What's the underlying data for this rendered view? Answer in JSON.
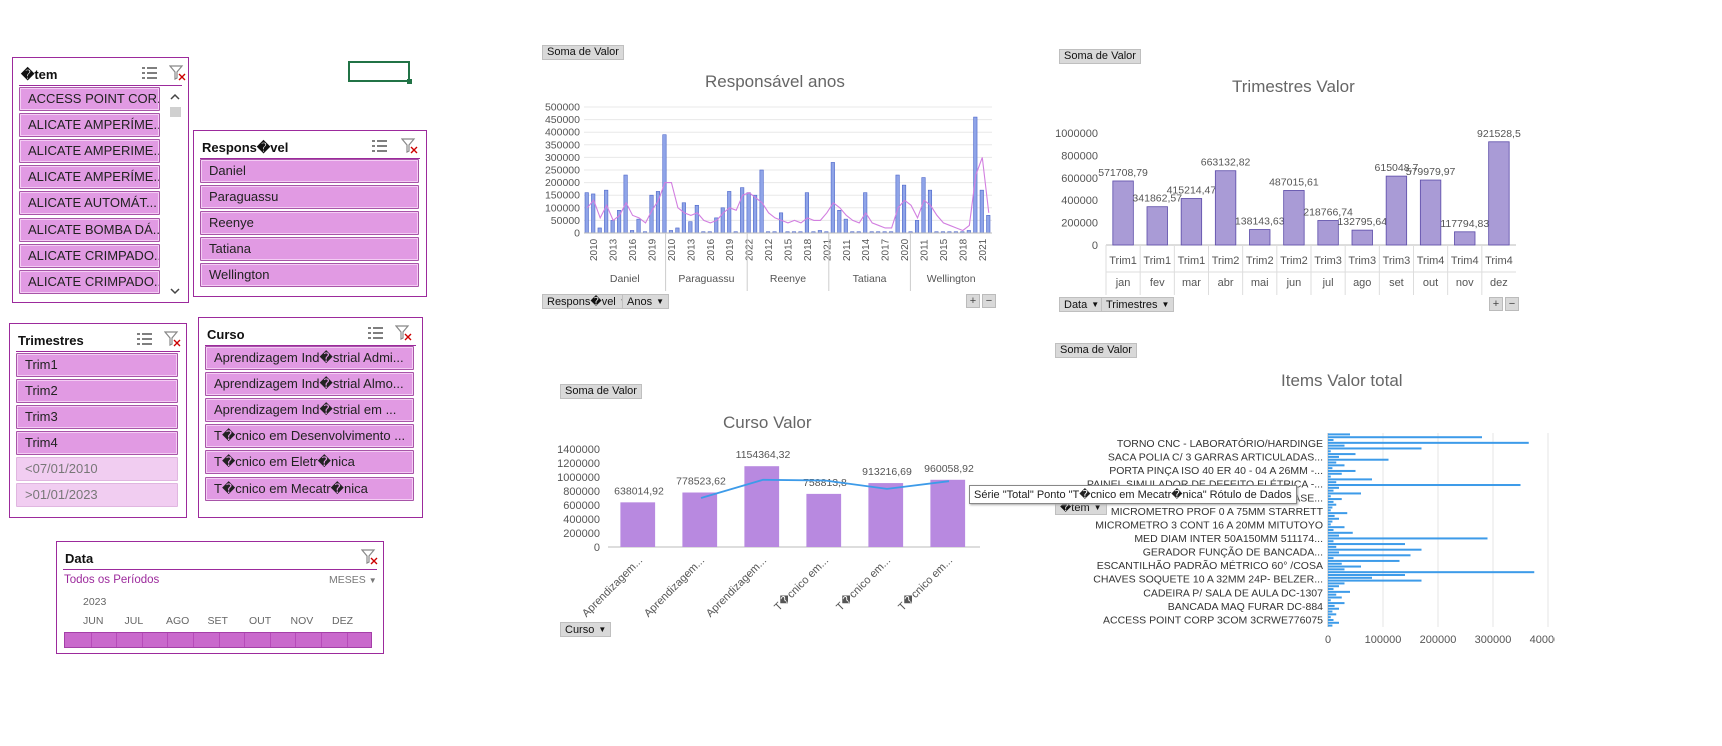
{
  "slicers": {
    "item": {
      "title": "�tem",
      "items": [
        "ACCESS POINT COR...",
        "ALICATE AMPERÍME...",
        "ALICATE AMPERIME...",
        "ALICATE AMPERÍME...",
        "ALICATE AUTOMÁT...",
        "ALICATE BOMBA DÁ...",
        "ALICATE CRIMPADO...",
        "ALICATE CRIMPADO..."
      ]
    },
    "responsavel": {
      "title": "Respons�vel",
      "items": [
        "Daniel",
        "Paraguassu",
        "Reenye",
        "Tatiana",
        "Wellington"
      ]
    },
    "trimestres": {
      "title": "Trimestres",
      "items": [
        "Trim1",
        "Trim2",
        "Trim3",
        "Trim4"
      ],
      "dim_items": [
        "<07/01/2010",
        ">01/01/2023"
      ]
    },
    "curso": {
      "title": "Curso",
      "items": [
        "Aprendizagem Ind�strial Admi...",
        "Aprendizagem Ind�strial Almo...",
        "Aprendizagem Ind�strial em ...",
        "T�cnico em Desenvolvimento ...",
        "T�cnico em Eletr�nica",
        "T�cnico em Mecatr�nica"
      ]
    },
    "data": {
      "title": "Data",
      "period_label": "Todos os Períodos",
      "level": "MESES",
      "year": "2023",
      "months": [
        "JUN",
        "JUL",
        "AGO",
        "SET",
        "OUT",
        "NOV",
        "DEZ"
      ]
    }
  },
  "icons": {
    "multiselect": "multiselect-icon",
    "clear_filter": "clear-filter-icon",
    "dropdown": "chevron-down-icon"
  },
  "colors": {
    "slicer_border": "#9c2a9c",
    "slicer_item": "#e19ae3",
    "bar_blue": "#8fa4e8",
    "bar_purple": "#a99bd6",
    "bar_violet": "#b889e0",
    "line_blue": "#3d9be9",
    "line_pink": "#d27fe0"
  },
  "chart_data": [
    {
      "type": "bar",
      "title": "Responsável anos",
      "field_button": "Soma de Valor",
      "filter_buttons": [
        "Respons�vel",
        "Anos"
      ],
      "groups": [
        "Daniel",
        "Paraguassu",
        "Reenye",
        "Tatiana",
        "Wellington"
      ],
      "x": [
        "2010",
        "2013",
        "2016",
        "2019",
        "2010",
        "2013",
        "2016",
        "2019",
        "2022",
        "2012",
        "2015",
        "2018",
        "2021",
        "2011",
        "2014",
        "2017",
        "2020",
        "2011",
        "2015",
        "2018",
        "2021"
      ],
      "y_ticks": [
        "0",
        "50000",
        "100000",
        "150000",
        "200000",
        "250000",
        "300000",
        "350000",
        "400000",
        "450000",
        "500000"
      ],
      "ylim": [
        0,
        500000
      ],
      "bar_values": [
        160000,
        155000,
        20000,
        170000,
        50000,
        90000,
        230000,
        10000,
        55000,
        5000,
        150000,
        165000,
        390000,
        10000,
        20000,
        120000,
        45000,
        110000,
        5000,
        5000,
        60000,
        100000,
        165000,
        5000,
        180000,
        160000,
        150000,
        250000,
        5000,
        5000,
        80000,
        5000,
        5000,
        5000,
        160000,
        5000,
        10000,
        5000,
        280000,
        90000,
        55000,
        5000,
        5000,
        160000,
        5000,
        5000,
        5000,
        5000,
        230000,
        190000,
        5000,
        50000,
        220000,
        170000,
        5000,
        5000,
        5000,
        5000,
        5000,
        10000,
        460000,
        170000,
        70000
      ],
      "line_values": [
        100000,
        130000,
        60000,
        110000,
        50000,
        70000,
        120000,
        70000,
        60000,
        40000,
        90000,
        130000,
        200000,
        200000,
        100000,
        80000,
        70000,
        80000,
        50000,
        40000,
        50000,
        80000,
        100000,
        90000,
        150000,
        160000,
        140000,
        120000,
        80000,
        60000,
        50000,
        40000,
        50000,
        40000,
        60000,
        50000,
        50000,
        80000,
        120000,
        100000,
        70000,
        50000,
        40000,
        80000,
        40000,
        30000,
        20000,
        20000,
        100000,
        130000,
        110000,
        60000,
        130000,
        110000,
        70000,
        40000,
        30000,
        20000,
        10000,
        30000,
        230000,
        300000,
        80000
      ]
    },
    {
      "type": "bar",
      "title": "Trimestres Valor",
      "field_button": "Soma de Valor",
      "filter_buttons": [
        "Data",
        "Trimestres"
      ],
      "categories": [
        "jan",
        "fev",
        "mar",
        "abr",
        "mai",
        "jun",
        "jul",
        "ago",
        "set",
        "out",
        "nov",
        "dez"
      ],
      "quarters": [
        "Trim1",
        "Trim1",
        "Trim1",
        "Trim2",
        "Trim2",
        "Trim2",
        "Trim3",
        "Trim3",
        "Trim3",
        "Trim4",
        "Trim4",
        "Trim4"
      ],
      "values": [
        571708.79,
        341862.57,
        415214.47,
        663132.82,
        138143.63,
        487015.61,
        218766.74,
        132795.64,
        615048.7,
        579979.97,
        117794.83,
        921528.5
      ],
      "data_labels": [
        "571708,79",
        "341862,57",
        "415214,47",
        "663132,82",
        "138143,63",
        "487015,61",
        "218766,74",
        "132795,64",
        "615048,7",
        "579979,97",
        "117794,83",
        "921528,5"
      ],
      "y_ticks": [
        "0",
        "200000",
        "400000",
        "600000",
        "800000",
        "1000000"
      ],
      "ylim": [
        0,
        1000000
      ]
    },
    {
      "type": "bar",
      "title": "Curso Valor",
      "field_button": "Soma de Valor",
      "filter_buttons": [
        "Curso"
      ],
      "categories": [
        "Aprendizagem...",
        "Aprendizagem...",
        "Aprendizagem...",
        "T�cnico em...",
        "T�cnico em...",
        "T�cnico em..."
      ],
      "values": [
        638014.92,
        778523.62,
        1154364.32,
        758813.8,
        913216.69,
        960058.92
      ],
      "data_labels": [
        "638014,92",
        "778523,62",
        "1154364,32",
        "758813,8",
        "913216,69",
        "960058,92"
      ],
      "line_values": [
        null,
        700000,
        960000,
        950000,
        830000,
        940000
      ],
      "y_ticks": [
        "0",
        "200000",
        "400000",
        "600000",
        "800000",
        "1000000",
        "1200000",
        "1400000"
      ],
      "ylim": [
        0,
        1400000
      ],
      "tooltip": "Série \"Total\" Ponto \"T�cnico em Mecatr�nica\" Rótulo de Dados"
    },
    {
      "type": "bar",
      "orientation": "horizontal",
      "title": "Items Valor total",
      "field_button": "Soma de Valor",
      "filter_buttons": [
        "�tem"
      ],
      "visible_category_labels": [
        "TORNO CNC - LABORATÓRIO/HARDINGE",
        "SACA POLIA C/ 3 GARRAS ARTICULADAS...",
        "PORTA PINÇA ISO 40 ER 40 - 04 A 26MM -...",
        "PAINEL SIMULADOR DE DEFEITO ELÉTRICA -...",
        "MULTIMETRO MINIPA ET2082 COM BASE...",
        "MICROMETRO PROF 0 A 75MM STARRETT",
        "MICROMETRO 3 CONT 16 A 20MM MITUTOYO",
        "MED DIAM INTER 50A150MM 511174...",
        "GERADOR FUNÇÃO DE BANCADA...",
        "ESCANTILHÃO PADRÃO MÉTRICO 60° /COSA",
        "CHAVES SOQUETE 10 A 32MM 24P- BELZER...",
        "CADEIRA P/ SALA DE AULA DC-1307",
        "BANCADA MAQ FURAR DC-884",
        "ACCESS POINT CORP 3COM 3CRWE776075"
      ],
      "x_ticks": [
        "0",
        "100000",
        "200000",
        "300000",
        "400000"
      ],
      "xlim": [
        0,
        400000
      ],
      "values": [
        40000,
        280000,
        10000,
        365000,
        30000,
        170000,
        5000,
        50000,
        20000,
        110000,
        15000,
        30000,
        8000,
        50000,
        25000,
        5000,
        80000,
        15000,
        350000,
        20000,
        10000,
        60000,
        5000,
        25000,
        10000,
        15000,
        8000,
        5000,
        35000,
        12000,
        20000,
        8000,
        5000,
        30000,
        10000,
        45000,
        20000,
        290000,
        10000,
        140000,
        15000,
        170000,
        20000,
        150000,
        10000,
        130000,
        25000,
        60000,
        30000,
        375000,
        140000,
        80000,
        170000,
        30000,
        20000,
        10000,
        40000,
        15000,
        25000,
        5000,
        30000,
        12000,
        20000,
        8000,
        15000,
        5000,
        10000,
        20000,
        8000
      ]
    }
  ]
}
